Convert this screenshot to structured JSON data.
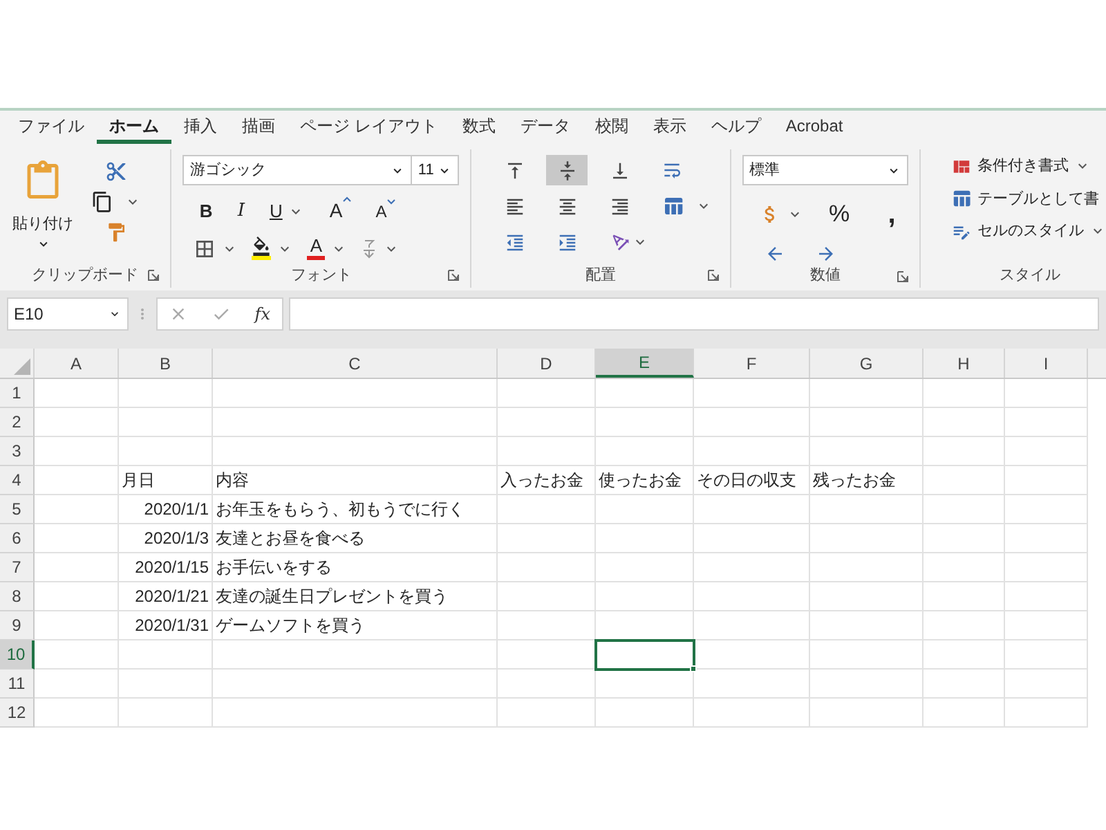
{
  "tabs": [
    {
      "label": "ファイル",
      "selected": false
    },
    {
      "label": "ホーム",
      "selected": true
    },
    {
      "label": "挿入",
      "selected": false
    },
    {
      "label": "描画",
      "selected": false
    },
    {
      "label": "ページ レイアウト",
      "selected": false
    },
    {
      "label": "数式",
      "selected": false
    },
    {
      "label": "データ",
      "selected": false
    },
    {
      "label": "校閲",
      "selected": false
    },
    {
      "label": "表示",
      "selected": false
    },
    {
      "label": "ヘルプ",
      "selected": false
    },
    {
      "label": "Acrobat",
      "selected": false
    }
  ],
  "ribbon": {
    "clipboard": {
      "paste_label": "貼り付け",
      "group_label": "クリップボード"
    },
    "font": {
      "font_name": "游ゴシック",
      "font_size": "11",
      "bold": "B",
      "italic": "I",
      "underline": "U",
      "grow": "A",
      "shrink": "A",
      "font_color": "A",
      "group_label": "フォント"
    },
    "alignment": {
      "vertical": [
        {
          "selected": false
        },
        {
          "selected": true
        },
        {
          "selected": false
        }
      ],
      "group_label": "配置"
    },
    "number": {
      "format": "標準",
      "percent": "%",
      "comma": ",",
      "group_label": "数値"
    },
    "styles": {
      "items": [
        "条件付き書式",
        "テーブルとして書",
        "セルのスタイル"
      ],
      "group_label": "スタイル"
    }
  },
  "formula_bar": {
    "name_box": "E10",
    "function_label": "fx"
  },
  "grid": {
    "columns": [
      {
        "label": "A",
        "selected": false
      },
      {
        "label": "B",
        "selected": false
      },
      {
        "label": "C",
        "selected": false
      },
      {
        "label": "D",
        "selected": false
      },
      {
        "label": "E",
        "selected": true
      },
      {
        "label": "F",
        "selected": false
      },
      {
        "label": "G",
        "selected": false
      },
      {
        "label": "H",
        "selected": false
      },
      {
        "label": "I",
        "selected": false
      }
    ],
    "rows": [
      {
        "label": "1",
        "selected": false
      },
      {
        "label": "2",
        "selected": false
      },
      {
        "label": "3",
        "selected": false
      },
      {
        "label": "4",
        "selected": false,
        "cells": {
          "B": {
            "text": "月日",
            "kind": "text"
          },
          "C": {
            "text": "内容",
            "kind": "text"
          },
          "D": {
            "text": "入ったお金",
            "kind": "text"
          },
          "E": {
            "text": "使ったお金",
            "kind": "text"
          },
          "F": {
            "text": "その日の収支",
            "kind": "text"
          },
          "G": {
            "text": "残ったお金",
            "kind": "text"
          }
        }
      },
      {
        "label": "5",
        "selected": false,
        "cells": {
          "B": {
            "text": "2020/1/1",
            "kind": "date"
          },
          "C": {
            "text": "お年玉をもらう、初もうでに行く",
            "kind": "text"
          }
        }
      },
      {
        "label": "6",
        "selected": false,
        "cells": {
          "B": {
            "text": "2020/1/3",
            "kind": "date"
          },
          "C": {
            "text": "友達とお昼を食べる",
            "kind": "text"
          }
        }
      },
      {
        "label": "7",
        "selected": false,
        "cells": {
          "B": {
            "text": "2020/1/15",
            "kind": "date"
          },
          "C": {
            "text": "お手伝いをする",
            "kind": "text"
          }
        }
      },
      {
        "label": "8",
        "selected": false,
        "cells": {
          "B": {
            "text": "2020/1/21",
            "kind": "date"
          },
          "C": {
            "text": "友達の誕生日プレゼントを買う",
            "kind": "text"
          }
        }
      },
      {
        "label": "9",
        "selected": false,
        "cells": {
          "B": {
            "text": "2020/1/31",
            "kind": "date"
          },
          "C": {
            "text": "ゲームソフトを買う",
            "kind": "text"
          }
        }
      },
      {
        "label": "10",
        "selected": true
      },
      {
        "label": "11",
        "selected": false
      },
      {
        "label": "12",
        "selected": false
      }
    ]
  }
}
